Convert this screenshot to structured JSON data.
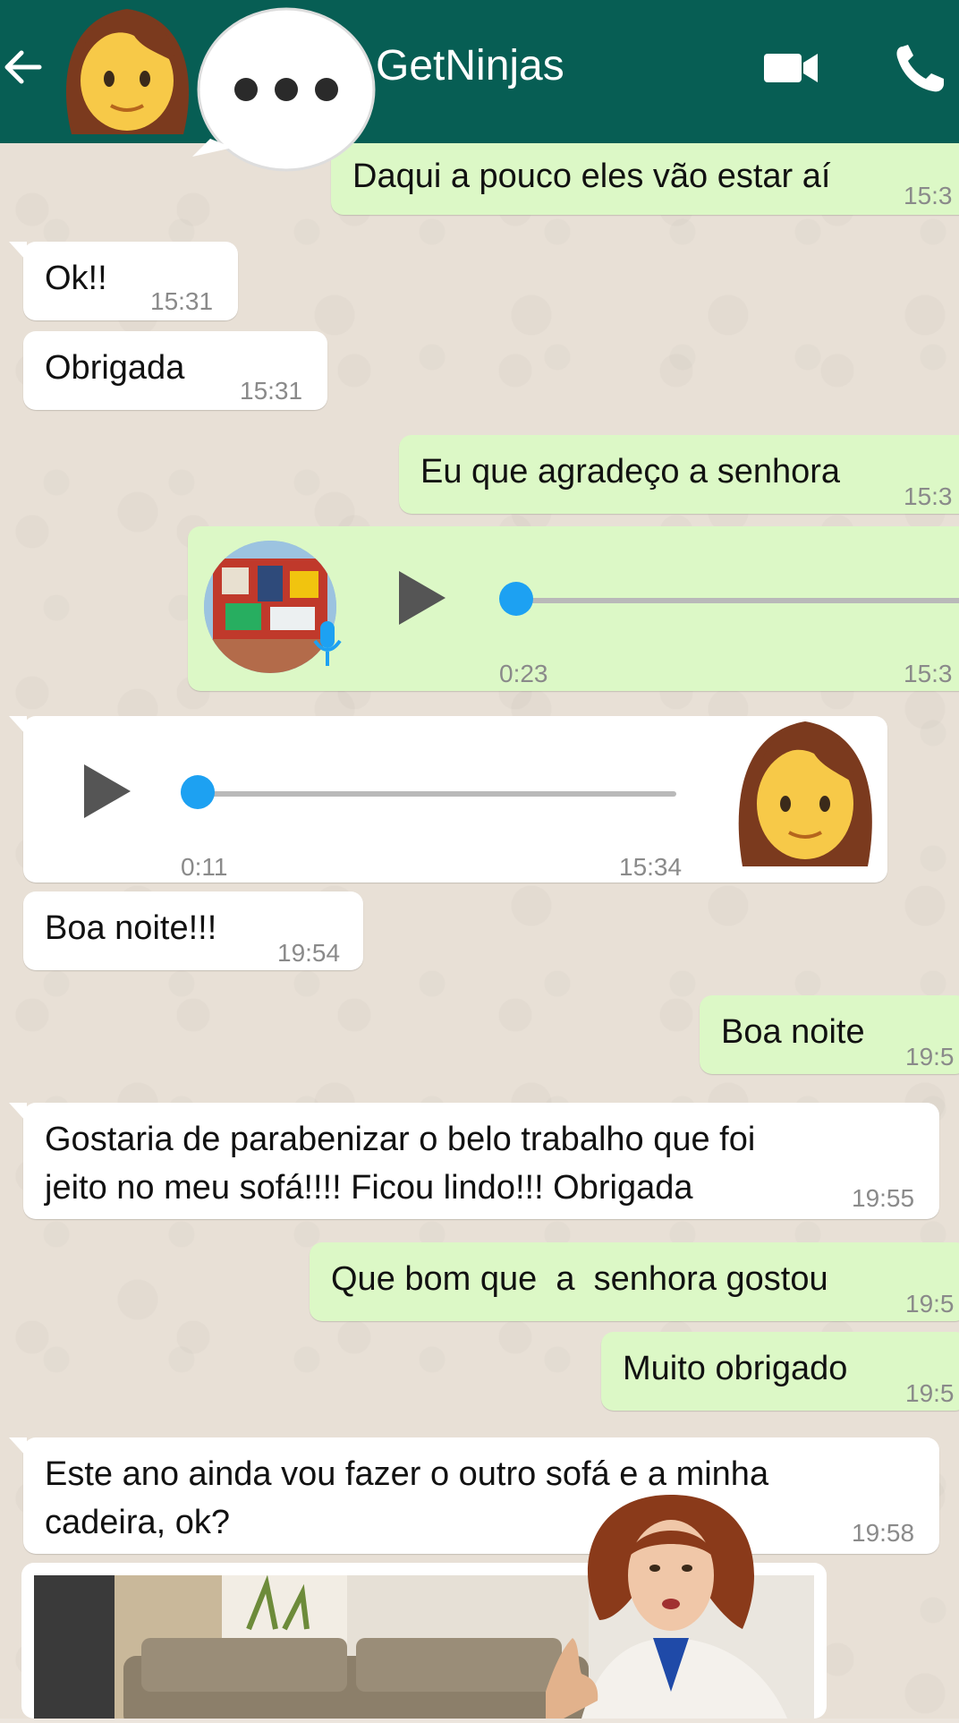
{
  "header": {
    "contact_name": "GetNinjas"
  },
  "colors": {
    "header_bg": "#075e54",
    "incoming_bubble": "#ffffff",
    "outgoing_bubble": "#dcf8c6",
    "audio_knob": "#1da1f2"
  },
  "icons": {
    "back": "arrow-left-icon",
    "video": "video-camera-icon",
    "call": "phone-icon",
    "typing": "typing-dots-icon",
    "mic": "microphone-icon"
  },
  "messages": [
    {
      "dir": "out",
      "text": "Daqui a pouco eles vão estar aí",
      "time": "15:3"
    },
    {
      "dir": "in",
      "text": "Ok!!",
      "time": "15:31"
    },
    {
      "dir": "in",
      "text": "Obrigada",
      "time": "15:31"
    },
    {
      "dir": "out",
      "text": "Eu que agradeço a senhora",
      "time": "15:3"
    },
    {
      "dir": "out",
      "type": "voice",
      "duration": "0:23",
      "time": "15:3"
    },
    {
      "dir": "in",
      "type": "voice",
      "duration": "0:11",
      "time": "15:34"
    },
    {
      "dir": "in",
      "text": "Boa noite!!!",
      "time": "19:54"
    },
    {
      "dir": "out",
      "text": "Boa noite",
      "time": "19:5"
    },
    {
      "dir": "in",
      "text": "Gostaria de parabenizar o belo trabalho que foi\njeito no meu sofá!!!! Ficou lindo!!! Obrigada",
      "time": "19:55"
    },
    {
      "dir": "out",
      "text": "Que bom que  a  senhora gostou",
      "time": "19:5"
    },
    {
      "dir": "out",
      "text": "Muito obrigado",
      "time": "19:5"
    },
    {
      "dir": "in",
      "text": "Este ano ainda vou fazer o outro sofá e a minha\ncadeira, ok?",
      "time": "19:58"
    }
  ]
}
